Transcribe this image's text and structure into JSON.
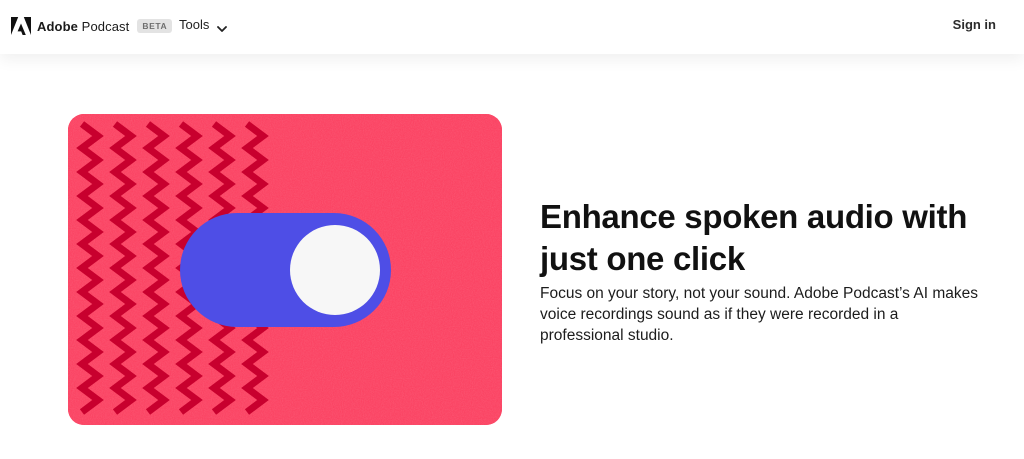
{
  "nav": {
    "brand_bold": "Adobe",
    "brand_light": "Podcast",
    "badge": "BETA",
    "tools_label": "Tools",
    "signin_label": "Sign in",
    "logo_icon": "adobe-logo-icon",
    "chevron_icon": "chevron-down-icon"
  },
  "hero": {
    "illustration": "toggle-switch-illustration",
    "headline": "Enhance spoken audio with just one click",
    "description": "Focus on your story, not your sound. Adobe Podcast’s AI makes voice recordings sound as if they were recorded in a professional studio."
  },
  "colors": {
    "card_background": "#fb3b5c",
    "zigzag": "#c8002e",
    "toggle_track": "#4e4ee6",
    "toggle_knob": "#f7f7f7"
  }
}
